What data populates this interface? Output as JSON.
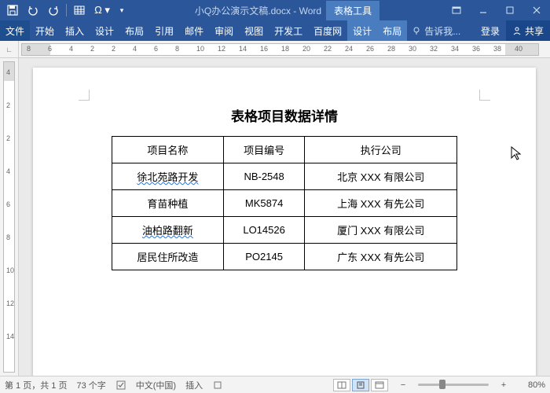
{
  "titlebar": {
    "filename": "小Q办公演示文稿.docx - Word",
    "context_tab": "表格工具"
  },
  "qat": {
    "save": "保存",
    "undo": "撤销",
    "redo": "重做"
  },
  "ribbon": {
    "file": "文件",
    "tabs": [
      "开始",
      "插入",
      "设计",
      "布局",
      "引用",
      "邮件",
      "审阅",
      "视图",
      "开发工",
      "百度网"
    ],
    "ctx_tabs": [
      "设计",
      "布局"
    ],
    "tell_me": "告诉我...",
    "login": "登录",
    "share": "共享"
  },
  "ruler": {
    "h_nums": [
      "8",
      "6",
      "4",
      "2",
      "2",
      "4",
      "6",
      "8",
      "10",
      "12",
      "14",
      "16",
      "18",
      "20",
      "22",
      "24",
      "26",
      "28",
      "30",
      "32",
      "34",
      "36",
      "38",
      "40"
    ]
  },
  "vruler": {
    "nums": [
      "4",
      "2",
      "2",
      "4",
      "6",
      "8",
      "10",
      "12",
      "14"
    ]
  },
  "document": {
    "title": "表格项目数据详情",
    "headers": [
      "项目名称",
      "项目编号",
      "执行公司"
    ],
    "rows": [
      {
        "name": "徐北苑路开发",
        "code": "NB-2548",
        "company": "北京 XXX 有限公司",
        "wavy": true
      },
      {
        "name": "育苗种植",
        "code": "MK5874",
        "company": "上海 XXX 有先公司",
        "wavy": false
      },
      {
        "name": "油柏路翻新",
        "code": "LO14526",
        "company": "厦门 XXX 有限公司",
        "wavy": true
      },
      {
        "name": "居民住所改造",
        "code": "PO2145",
        "company": "广东 XXX 有先公司",
        "wavy": false
      }
    ]
  },
  "statusbar": {
    "page": "第 1 页，共 1 页",
    "words": "73 个字",
    "lang": "中文(中国)",
    "insert": "插入",
    "zoom": "80%"
  }
}
